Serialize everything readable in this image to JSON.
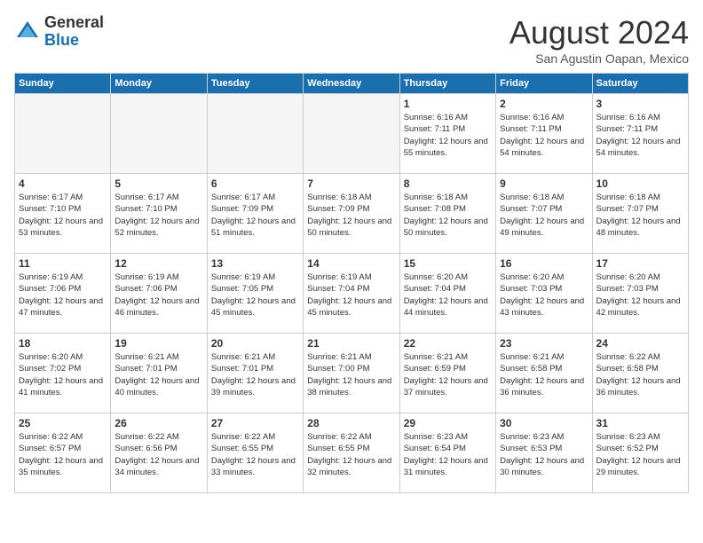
{
  "header": {
    "logo_general": "General",
    "logo_blue": "Blue",
    "month_year": "August 2024",
    "location": "San Agustin Oapan, Mexico"
  },
  "days_of_week": [
    "Sunday",
    "Monday",
    "Tuesday",
    "Wednesday",
    "Thursday",
    "Friday",
    "Saturday"
  ],
  "weeks": [
    [
      {
        "day": "",
        "info": "",
        "empty": true
      },
      {
        "day": "",
        "info": "",
        "empty": true
      },
      {
        "day": "",
        "info": "",
        "empty": true
      },
      {
        "day": "",
        "info": "",
        "empty": true
      },
      {
        "day": "1",
        "info": "Sunrise: 6:16 AM\nSunset: 7:11 PM\nDaylight: 12 hours\nand 55 minutes."
      },
      {
        "day": "2",
        "info": "Sunrise: 6:16 AM\nSunset: 7:11 PM\nDaylight: 12 hours\nand 54 minutes."
      },
      {
        "day": "3",
        "info": "Sunrise: 6:16 AM\nSunset: 7:11 PM\nDaylight: 12 hours\nand 54 minutes."
      }
    ],
    [
      {
        "day": "4",
        "info": "Sunrise: 6:17 AM\nSunset: 7:10 PM\nDaylight: 12 hours\nand 53 minutes."
      },
      {
        "day": "5",
        "info": "Sunrise: 6:17 AM\nSunset: 7:10 PM\nDaylight: 12 hours\nand 52 minutes."
      },
      {
        "day": "6",
        "info": "Sunrise: 6:17 AM\nSunset: 7:09 PM\nDaylight: 12 hours\nand 51 minutes."
      },
      {
        "day": "7",
        "info": "Sunrise: 6:18 AM\nSunset: 7:09 PM\nDaylight: 12 hours\nand 50 minutes."
      },
      {
        "day": "8",
        "info": "Sunrise: 6:18 AM\nSunset: 7:08 PM\nDaylight: 12 hours\nand 50 minutes."
      },
      {
        "day": "9",
        "info": "Sunrise: 6:18 AM\nSunset: 7:07 PM\nDaylight: 12 hours\nand 49 minutes."
      },
      {
        "day": "10",
        "info": "Sunrise: 6:18 AM\nSunset: 7:07 PM\nDaylight: 12 hours\nand 48 minutes."
      }
    ],
    [
      {
        "day": "11",
        "info": "Sunrise: 6:19 AM\nSunset: 7:06 PM\nDaylight: 12 hours\nand 47 minutes."
      },
      {
        "day": "12",
        "info": "Sunrise: 6:19 AM\nSunset: 7:06 PM\nDaylight: 12 hours\nand 46 minutes."
      },
      {
        "day": "13",
        "info": "Sunrise: 6:19 AM\nSunset: 7:05 PM\nDaylight: 12 hours\nand 45 minutes."
      },
      {
        "day": "14",
        "info": "Sunrise: 6:19 AM\nSunset: 7:04 PM\nDaylight: 12 hours\nand 45 minutes."
      },
      {
        "day": "15",
        "info": "Sunrise: 6:20 AM\nSunset: 7:04 PM\nDaylight: 12 hours\nand 44 minutes."
      },
      {
        "day": "16",
        "info": "Sunrise: 6:20 AM\nSunset: 7:03 PM\nDaylight: 12 hours\nand 43 minutes."
      },
      {
        "day": "17",
        "info": "Sunrise: 6:20 AM\nSunset: 7:03 PM\nDaylight: 12 hours\nand 42 minutes."
      }
    ],
    [
      {
        "day": "18",
        "info": "Sunrise: 6:20 AM\nSunset: 7:02 PM\nDaylight: 12 hours\nand 41 minutes."
      },
      {
        "day": "19",
        "info": "Sunrise: 6:21 AM\nSunset: 7:01 PM\nDaylight: 12 hours\nand 40 minutes."
      },
      {
        "day": "20",
        "info": "Sunrise: 6:21 AM\nSunset: 7:01 PM\nDaylight: 12 hours\nand 39 minutes."
      },
      {
        "day": "21",
        "info": "Sunrise: 6:21 AM\nSunset: 7:00 PM\nDaylight: 12 hours\nand 38 minutes."
      },
      {
        "day": "22",
        "info": "Sunrise: 6:21 AM\nSunset: 6:59 PM\nDaylight: 12 hours\nand 37 minutes."
      },
      {
        "day": "23",
        "info": "Sunrise: 6:21 AM\nSunset: 6:58 PM\nDaylight: 12 hours\nand 36 minutes."
      },
      {
        "day": "24",
        "info": "Sunrise: 6:22 AM\nSunset: 6:58 PM\nDaylight: 12 hours\nand 36 minutes."
      }
    ],
    [
      {
        "day": "25",
        "info": "Sunrise: 6:22 AM\nSunset: 6:57 PM\nDaylight: 12 hours\nand 35 minutes."
      },
      {
        "day": "26",
        "info": "Sunrise: 6:22 AM\nSunset: 6:56 PM\nDaylight: 12 hours\nand 34 minutes."
      },
      {
        "day": "27",
        "info": "Sunrise: 6:22 AM\nSunset: 6:55 PM\nDaylight: 12 hours\nand 33 minutes."
      },
      {
        "day": "28",
        "info": "Sunrise: 6:22 AM\nSunset: 6:55 PM\nDaylight: 12 hours\nand 32 minutes."
      },
      {
        "day": "29",
        "info": "Sunrise: 6:23 AM\nSunset: 6:54 PM\nDaylight: 12 hours\nand 31 minutes."
      },
      {
        "day": "30",
        "info": "Sunrise: 6:23 AM\nSunset: 6:53 PM\nDaylight: 12 hours\nand 30 minutes."
      },
      {
        "day": "31",
        "info": "Sunrise: 6:23 AM\nSunset: 6:52 PM\nDaylight: 12 hours\nand 29 minutes."
      }
    ]
  ]
}
